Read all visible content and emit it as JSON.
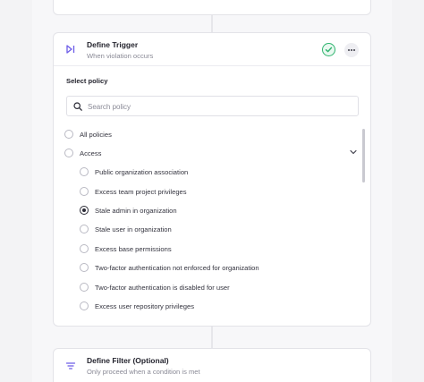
{
  "colors": {
    "accent": "#6c5ce7",
    "success": "#2fb46e",
    "text": "#2b2b36",
    "muted": "#8a8a96"
  },
  "trigger_step": {
    "icon": "skip-forward-icon",
    "title": "Define Trigger",
    "subtitle": "When violation occurs",
    "status_icon": "check-circle-icon",
    "menu_icon": "more-horizontal-icon"
  },
  "policy_picker": {
    "label": "Select policy",
    "search": {
      "placeholder": "Search policy",
      "value": ""
    },
    "options": [
      {
        "label": "All policies",
        "selected": false
      },
      {
        "label": "Access",
        "selected": false,
        "expanded": true
      }
    ],
    "access_policies": [
      {
        "label": "Public organization association",
        "selected": false
      },
      {
        "label": "Excess team project privileges",
        "selected": false
      },
      {
        "label": "Stale admin in organization",
        "selected": true
      },
      {
        "label": "Stale user in organization",
        "selected": false
      },
      {
        "label": "Excess base permissions",
        "selected": false
      },
      {
        "label": "Two-factor authentication not enforced for organization",
        "selected": false
      },
      {
        "label": "Two-factor authentication is disabled for user",
        "selected": false
      },
      {
        "label": "Excess user repository privileges",
        "selected": false
      }
    ]
  },
  "filter_step": {
    "icon": "filter-icon",
    "title": "Define Filter (Optional)",
    "subtitle": "Only proceed when a condition is met"
  }
}
